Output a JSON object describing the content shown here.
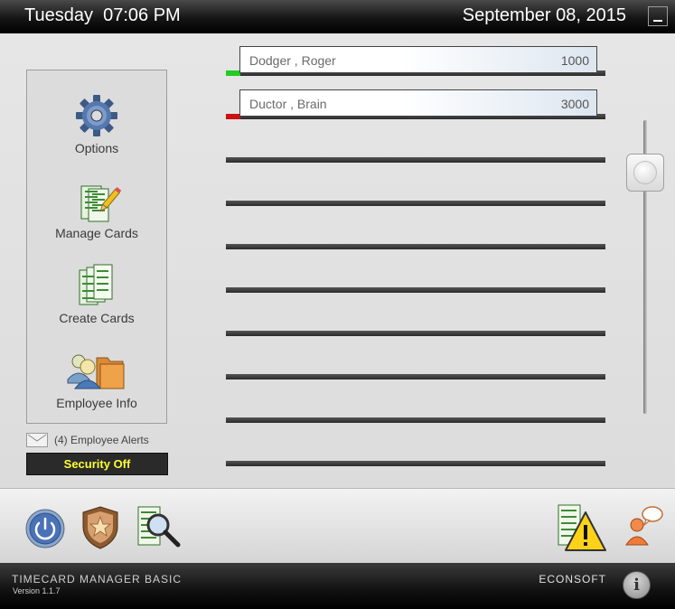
{
  "header": {
    "day": "Tuesday",
    "time": "07:06 PM",
    "date": "September 08, 2015",
    "minimize_icon": "minimize-icon"
  },
  "menu": {
    "items": [
      {
        "label": "Options",
        "icon": "gear-icon"
      },
      {
        "label": "Manage Cards",
        "icon": "manage-cards-icon"
      },
      {
        "label": "Create Cards",
        "icon": "create-cards-icon"
      },
      {
        "label": "Employee Info",
        "icon": "employee-info-icon"
      }
    ]
  },
  "alerts": {
    "text": "(4) Employee Alerts",
    "icon": "envelope-icon"
  },
  "security": {
    "label": "Security Off",
    "color": "#ffff33"
  },
  "cards": [
    {
      "name": "Dodger , Roger",
      "id": "1000",
      "status": "in",
      "status_color": "#22cc22"
    },
    {
      "name": "Ductor , Brain",
      "id": "3000",
      "status": "out",
      "status_color": "#cc1111"
    }
  ],
  "toolbar": {
    "left": [
      "power-icon",
      "security-shield-icon",
      "search-cards-icon"
    ],
    "right": [
      "alert-cards-icon",
      "support-chat-icon"
    ]
  },
  "footer": {
    "app_name": "TIMECARD MANAGER BASIC",
    "version": "Version 1.1.7",
    "brand": "ECONSOFT",
    "info_label": "i"
  }
}
